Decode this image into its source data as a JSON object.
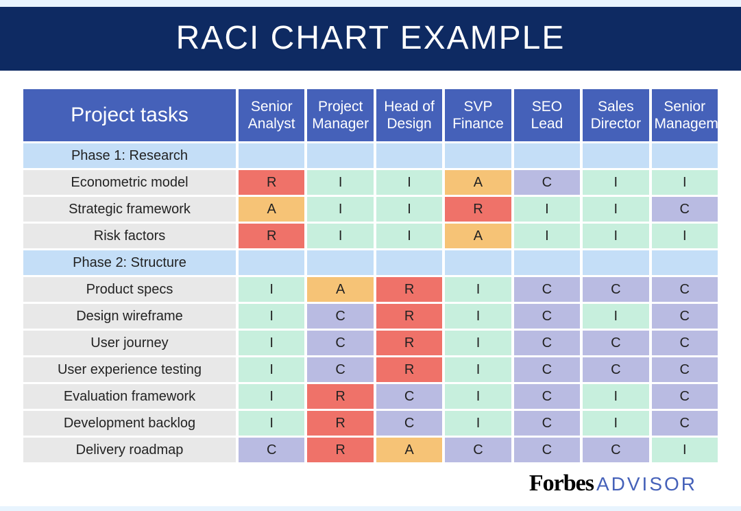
{
  "title": "RACI CHART EXAMPLE",
  "tasks_header": "Project tasks",
  "roles": [
    "Senior Analyst",
    "Project Manager",
    "Head of Design",
    "SVP Finance",
    "SEO Lead",
    "Sales Director",
    "Senior Management"
  ],
  "rows": [
    {
      "type": "phase",
      "label": "Phase 1: Research"
    },
    {
      "type": "task",
      "label": "Econometric model",
      "cells": [
        "R",
        "I",
        "I",
        "A",
        "C",
        "I",
        "I"
      ]
    },
    {
      "type": "task",
      "label": "Strategic framework",
      "cells": [
        "A",
        "I",
        "I",
        "R",
        "I",
        "I",
        "C"
      ]
    },
    {
      "type": "task",
      "label": "Risk factors",
      "cells": [
        "R",
        "I",
        "I",
        "A",
        "I",
        "I",
        "I"
      ]
    },
    {
      "type": "phase",
      "label": "Phase 2: Structure"
    },
    {
      "type": "task",
      "label": "Product specs",
      "cells": [
        "I",
        "A",
        "R",
        "I",
        "C",
        "C",
        "C"
      ]
    },
    {
      "type": "task",
      "label": "Design wireframe",
      "cells": [
        "I",
        "C",
        "R",
        "I",
        "C",
        "I",
        "C"
      ]
    },
    {
      "type": "task",
      "label": "User journey",
      "cells": [
        "I",
        "C",
        "R",
        "I",
        "C",
        "C",
        "C"
      ]
    },
    {
      "type": "task",
      "label": "User experience testing",
      "cells": [
        "I",
        "C",
        "R",
        "I",
        "C",
        "C",
        "C"
      ]
    },
    {
      "type": "task",
      "label": "Evaluation framework",
      "cells": [
        "I",
        "R",
        "C",
        "I",
        "C",
        "I",
        "C"
      ]
    },
    {
      "type": "task",
      "label": "Development backlog",
      "cells": [
        "I",
        "R",
        "C",
        "I",
        "C",
        "I",
        "C"
      ]
    },
    {
      "type": "task",
      "label": "Delivery roadmap",
      "cells": [
        "C",
        "R",
        "A",
        "C",
        "C",
        "C",
        "I"
      ]
    }
  ],
  "footer_brand": "Forbes",
  "footer_sub": "ADVISOR",
  "colors": {
    "R": "#ef7269",
    "A": "#f6c376",
    "C": "#b9bbe2",
    "I": "#c7efdd",
    "phase": "#c4def7",
    "header": "#4561b9",
    "banner": "#0e2a62"
  }
}
